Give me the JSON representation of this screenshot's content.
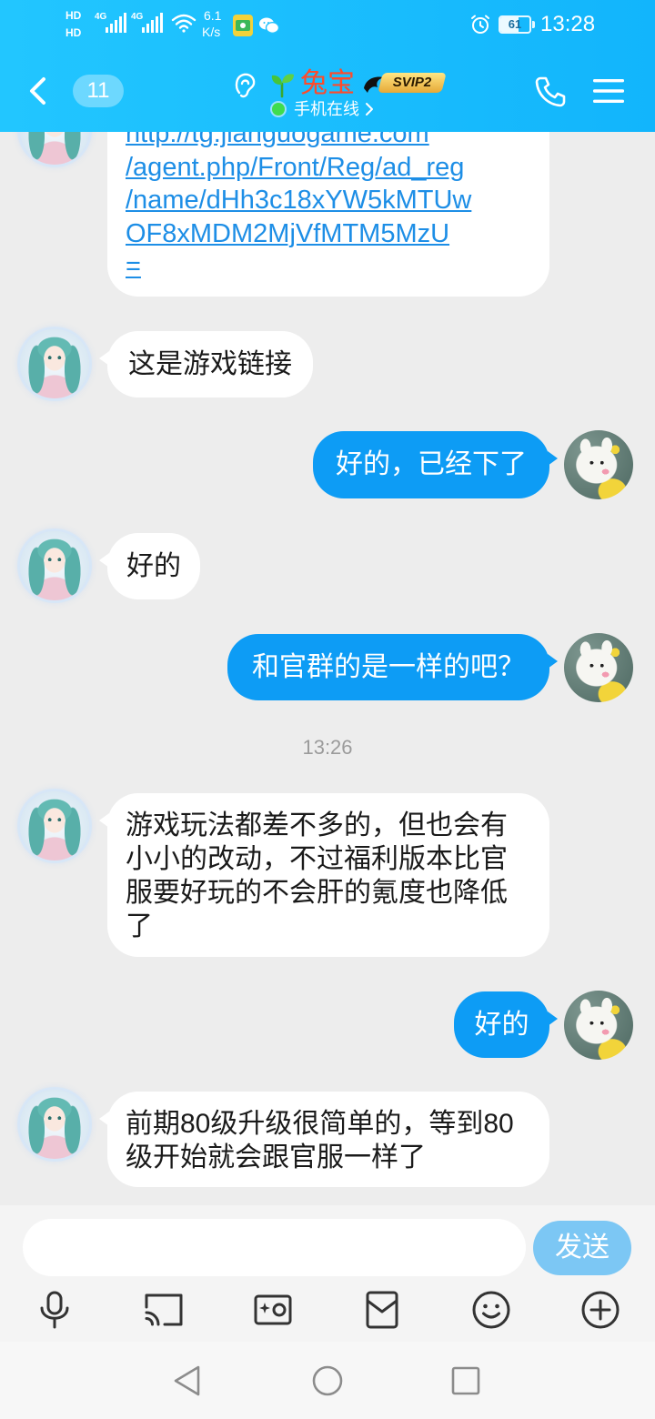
{
  "status_bar": {
    "hd_label_top": "HD",
    "hd_label_bottom": "HD",
    "network_type_1": "4G",
    "network_type_2": "4G",
    "speed_value": "6.1",
    "speed_unit": "K/s",
    "battery_level": "61",
    "time": "13:28",
    "icons": [
      "signal-icon",
      "wifi-icon",
      "app-notification-icon",
      "wechat-icon",
      "alarm-icon",
      "battery-icon"
    ]
  },
  "header": {
    "unread_count": "11",
    "contact_name": "兔宝",
    "vip_badge": "SVIP2",
    "online_status": "手机在线",
    "icons": [
      "chevron-left-icon",
      "ear-icon",
      "sprout-icon",
      "phone-icon",
      "menu-icon"
    ]
  },
  "messages": [
    {
      "lines": [
        "http://tg.jianguogame.com",
        "/agent.php/Front/Reg/ad_reg",
        "/name/dHh3c18xYW5kMTUw",
        "OF8xMDM2MjVfMTM5MzU",
        "="
      ]
    },
    {
      "lines": [
        "这是游戏链接"
      ]
    },
    {
      "lines": [
        "好的，已经下了"
      ]
    },
    {
      "lines": [
        "好的"
      ]
    },
    {
      "lines": [
        "和官群的是一样的吧？"
      ]
    },
    {
      "lines": [
        "游戏玩法都差不多的，但也会有",
        "小小的改动，不过福利版本比官",
        "服要好玩的不会肝的氪度也降低",
        "了"
      ]
    },
    {
      "lines": [
        "好的"
      ]
    },
    {
      "lines": [
        "前期80级升级很简单的，等到80",
        "级开始就会跟官服一样了"
      ]
    }
  ],
  "timestamp": "13:26",
  "composer": {
    "input_value": "",
    "send_label": "发送"
  },
  "toolbar": {
    "icons": [
      "mic-icon",
      "cast-icon",
      "camera-icon",
      "red-packet-icon",
      "emoji-icon",
      "plus-icon"
    ]
  },
  "nav_bar": {
    "icons": [
      "back-triangle-icon",
      "home-circle-icon",
      "recents-square-icon"
    ]
  },
  "colors": {
    "header_gradient_start": "#22c6ff",
    "header_gradient_end": "#12b5fc",
    "chat_background": "#ededed",
    "sent_bubble": "#0d9cf5",
    "received_bubble": "#ffffff",
    "link_text": "#1d8ee6",
    "contact_name": "#ff4a2a",
    "send_button": "#7cc7f4",
    "online_dot": "#3fdc4f"
  }
}
